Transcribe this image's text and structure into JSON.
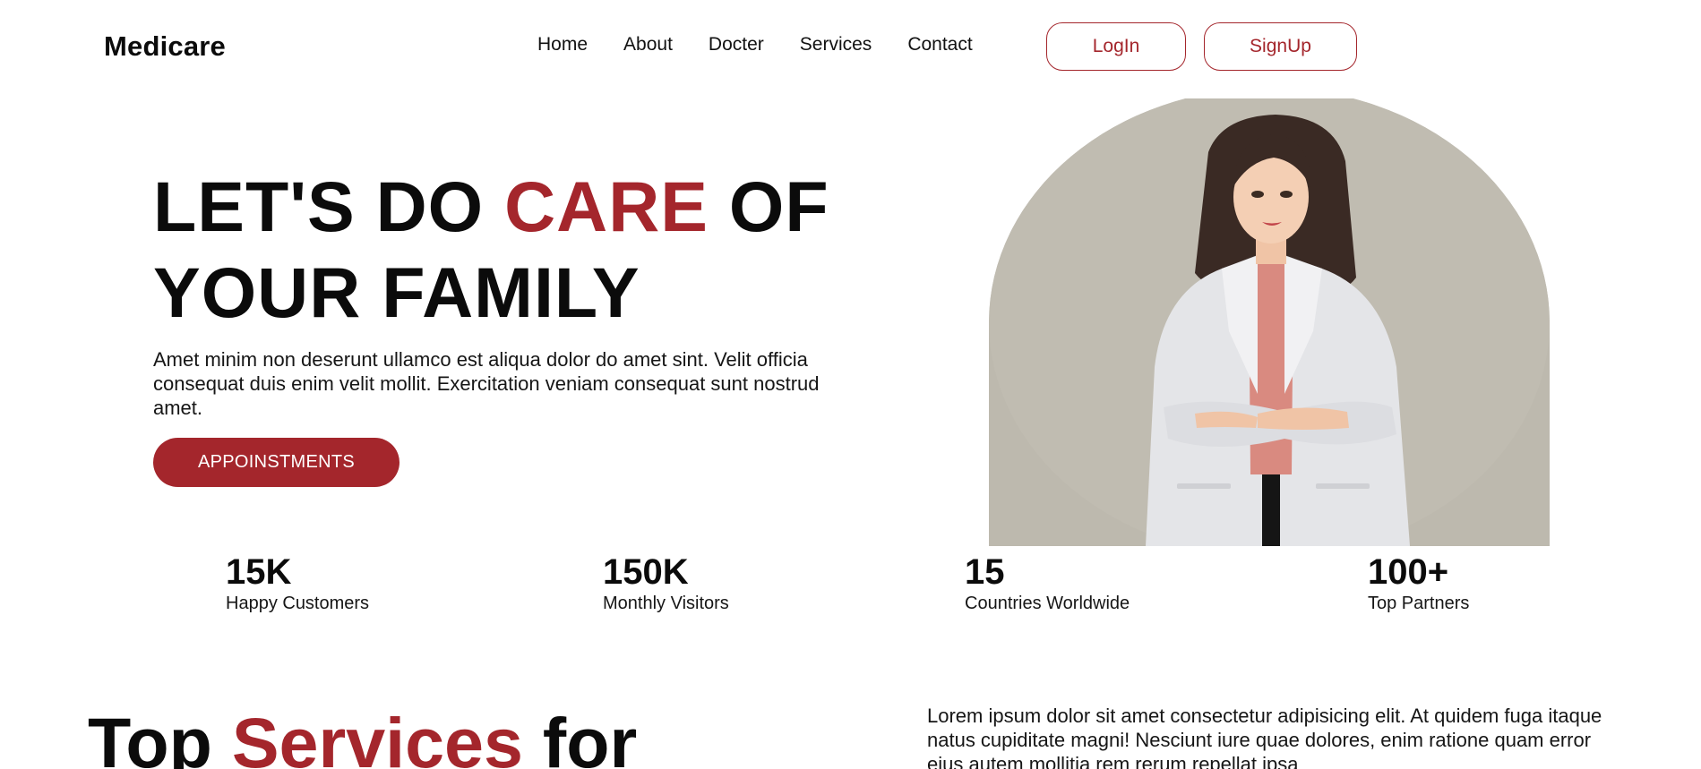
{
  "header": {
    "logo": "Medicare",
    "nav": [
      "Home",
      "About",
      "Docter",
      "Services",
      "Contact"
    ],
    "login_label": "LogIn",
    "signup_label": "SignUp"
  },
  "hero": {
    "title_part1": "LET'S DO ",
    "title_accent": "CARE",
    "title_part2": " OF YOUR FAMILY",
    "description": "Amet minim non deserunt ullamco est aliqua dolor do amet sint. Velit officia consequat duis enim velit mollit. Exercitation veniam consequat sunt nostrud amet.",
    "cta_label": "APPOINSTMENTS"
  },
  "stats": [
    {
      "value": "15K",
      "label": "Happy Customers"
    },
    {
      "value": "150K",
      "label": "Monthly Visitors"
    },
    {
      "value": "15",
      "label": "Countries Worldwide"
    },
    {
      "value": "100+",
      "label": "Top Partners"
    }
  ],
  "services": {
    "title_part1": "Top ",
    "title_accent": "Services",
    "title_part2": " for",
    "description": "Lorem ipsum dolor sit amet consectetur adipisicing elit. At quidem fuga itaque natus cupiditate magni! Nesciunt iure quae dolores, enim ratione quam error eius autem mollitia rem rerum repellat ipsa"
  },
  "colors": {
    "accent": "#a4262c",
    "image_bg": "#bdb9ae"
  }
}
